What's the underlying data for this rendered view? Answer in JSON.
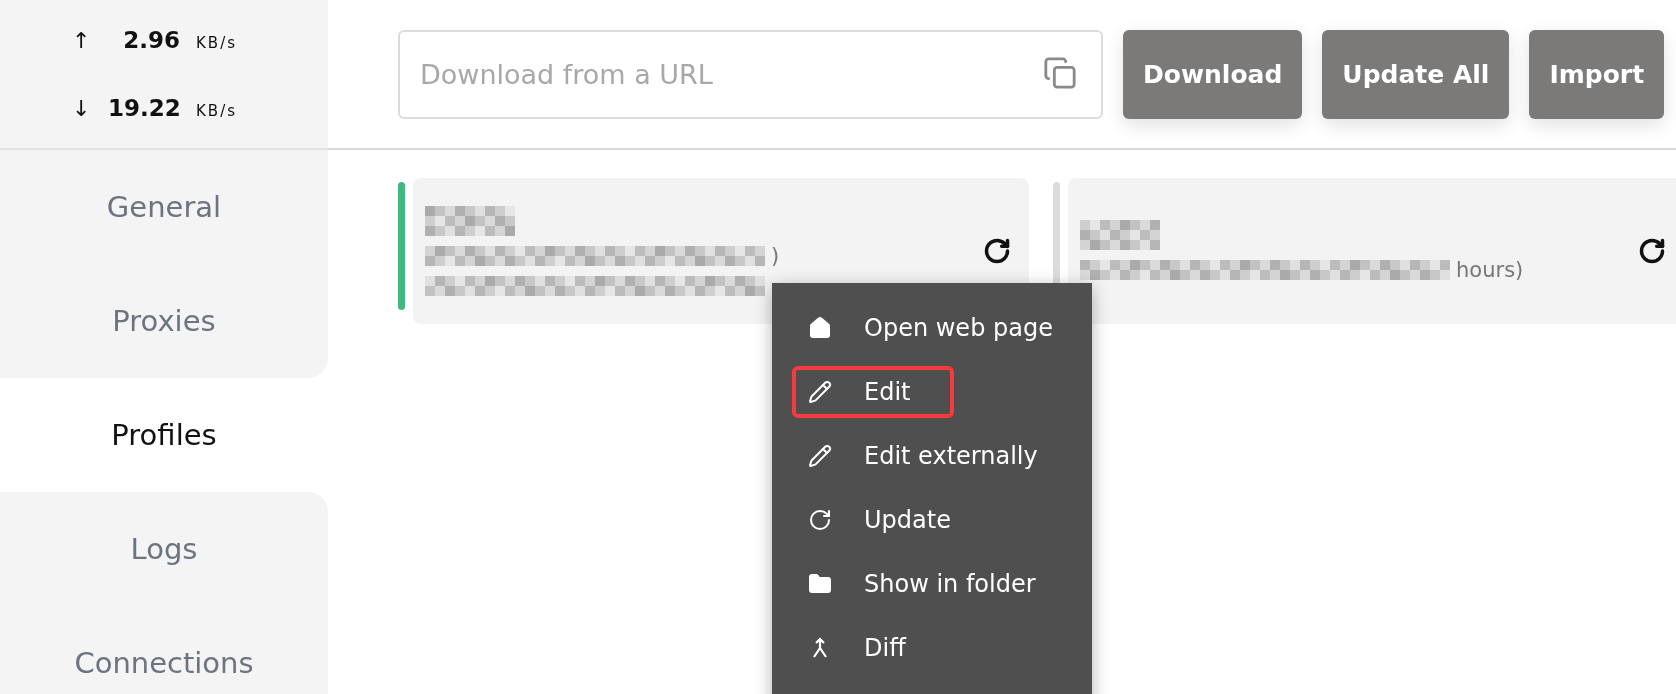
{
  "speed": {
    "upload": {
      "arrow": "↑",
      "value": "2.96",
      "unit": "KB/s"
    },
    "download": {
      "arrow": "↓",
      "value": "19.22",
      "unit": "KB/s"
    }
  },
  "nav": [
    {
      "label": "General",
      "selected": false
    },
    {
      "label": "Proxies",
      "selected": false
    },
    {
      "label": "Profiles",
      "selected": true
    },
    {
      "label": "Logs",
      "selected": false
    },
    {
      "label": "Connections",
      "selected": false
    }
  ],
  "url_field": {
    "placeholder": "Download from a URL"
  },
  "buttons": [
    "Download",
    "Update All",
    "Import"
  ],
  "profiles": [
    {
      "active": true,
      "trailing_text": ")"
    },
    {
      "active": false,
      "trailing_text": "hours)"
    }
  ],
  "context_menu": [
    {
      "kind": "home",
      "label": "Open web page",
      "outlined": false
    },
    {
      "kind": "edit",
      "label": "Edit",
      "outlined": true
    },
    {
      "kind": "edit",
      "label": "Edit externally",
      "outlined": false
    },
    {
      "kind": "update",
      "label": "Update",
      "outlined": false
    },
    {
      "kind": "folder",
      "label": "Show in folder",
      "outlined": false
    },
    {
      "kind": "diff",
      "label": "Diff",
      "outlined": false
    }
  ]
}
